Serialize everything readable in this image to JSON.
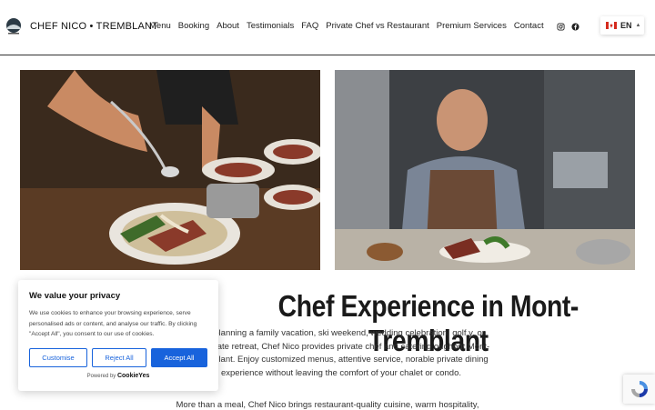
{
  "header": {
    "brand": "CHEF NICO • TREMBLANT",
    "nav": [
      "Menu",
      "Booking",
      "About",
      "Testimonials",
      "FAQ",
      "Private Chef vs Restaurant",
      "Premium Services",
      "Contact"
    ],
    "language": "EN"
  },
  "hero": {
    "title": "Chef Experience in Mont-Tremblant",
    "body": "u're planning a family vacation, ski weekend, wedding celebration, golf y, or corporate retreat, Chef Nico provides private chef and catering oughout Mont-Tremblant. Enjoy customized menus, attentive service, norable private dining experience without leaving the comfort of your chalet or condo.",
    "more": "More than a meal, Chef Nico brings restaurant-quality cuisine, warm hospitality,"
  },
  "cookie": {
    "title": "We value your privacy",
    "text": "We use cookies to enhance your browsing experience, serve personalised ads or content, and analyse our traffic. By clicking \"Accept All\", you consent to our use of cookies.",
    "customise": "Customise",
    "reject": "Reject All",
    "accept": "Accept All",
    "powered_by": "Powered by",
    "powered_brand": "CookieYes"
  },
  "colors": {
    "accent": "#1863dc",
    "text": "#222222"
  }
}
